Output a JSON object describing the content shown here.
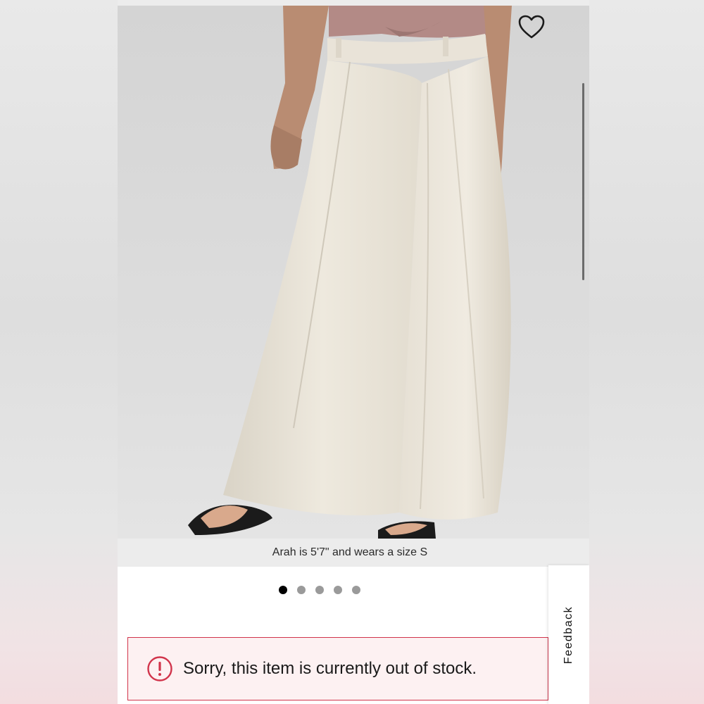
{
  "product": {
    "image_alt": "Model wearing wide-leg pleated trousers",
    "model_caption": "Arah is 5'7\" and wears a size S",
    "carousel": {
      "total": 5,
      "active_index": 0
    }
  },
  "alert": {
    "message": "Sorry, this item is currently out of stock."
  },
  "feedback": {
    "label": "Feedback"
  },
  "icons": {
    "favorite": "heart-icon",
    "alert": "exclamation-circle-icon"
  },
  "colors": {
    "alert_border": "#d1344b",
    "alert_background": "#fdf1f2",
    "dot_active": "#000000",
    "dot_inactive": "#9a9a9a"
  }
}
